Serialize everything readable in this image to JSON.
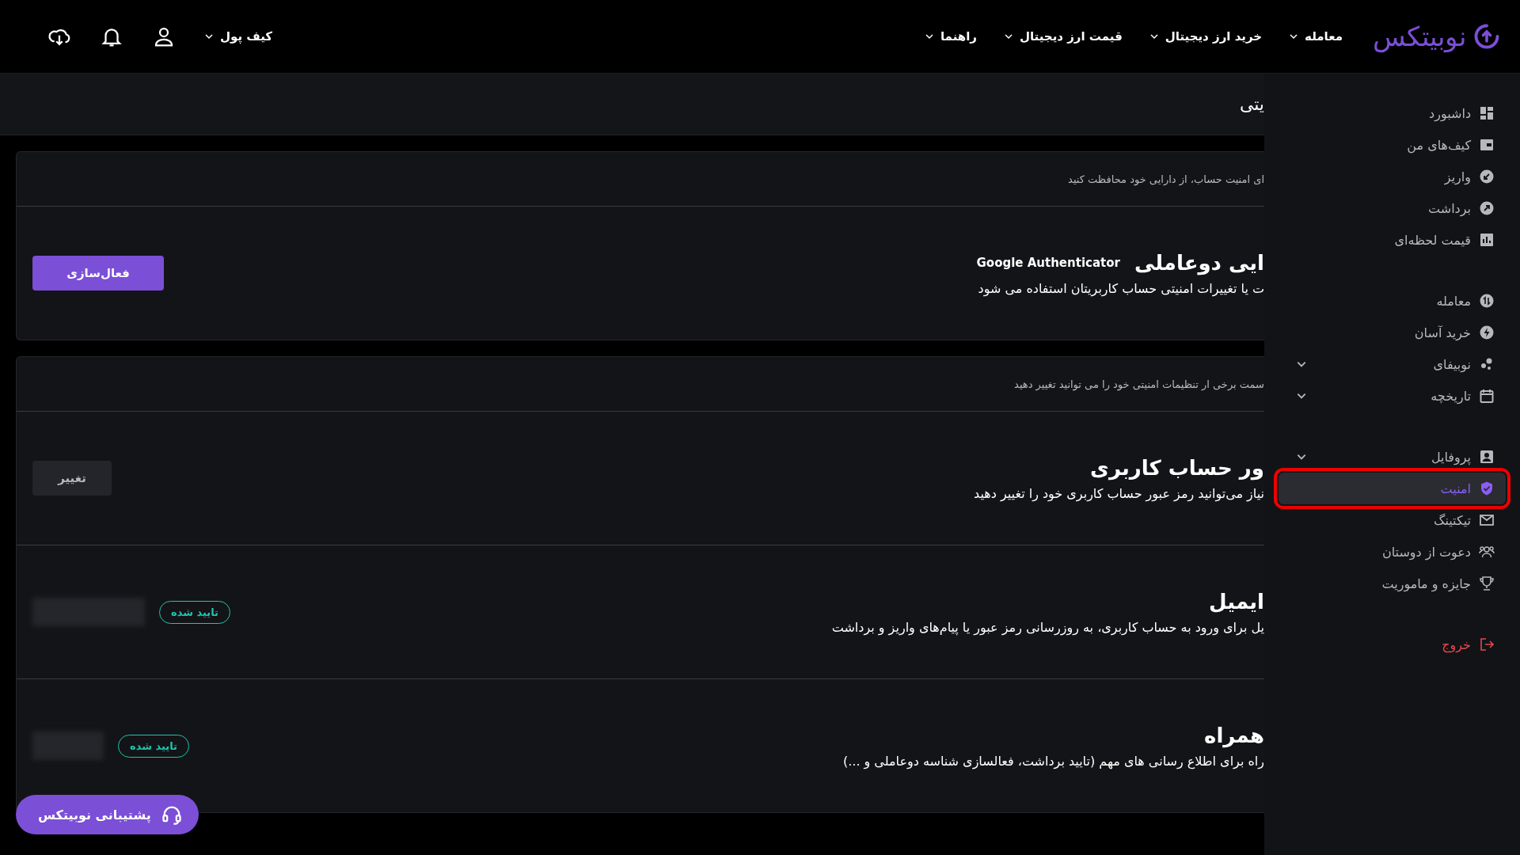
{
  "top_bar": {
    "logo": "نوبیتکس",
    "nav": [
      {
        "label": "معامله"
      },
      {
        "label": "خرید ارز دیجیتال"
      },
      {
        "label": "قیمت ارز دیجیتال"
      },
      {
        "label": "راهنما"
      }
    ],
    "wallet_menu": "کیف پول"
  },
  "page_title": "یتی",
  "cards": [
    {
      "intro": "ای امنیت حساب، از دارایی خود محافظت کنید",
      "rows": [
        {
          "kind": "button",
          "title": "ایی دوعاملی",
          "tag": "Google Authenticator",
          "description": "ت یا تغییرات امنیتی حساب کاربریتان استفاده می شود",
          "action": "فعال‌سازی",
          "primary": true
        }
      ]
    },
    {
      "intro": "سمت برخی ار تنظیمات امنیتی خود را می توانید تغییر دهید",
      "rows": [
        {
          "kind": "button",
          "title": "ور حساب کاربری",
          "description": "نیاز می‌توانید رمز عبور حساب کاربری خود را تغییر دهید",
          "action": "تغییر",
          "primary": false
        },
        {
          "kind": "verified",
          "title": "ایمیل",
          "description": "یل برای ورود به حساب کاربری، به روزرسانی رمز عبور یا پیام‌های واریز و برداشت",
          "badge": "تایید شده"
        },
        {
          "kind": "verified",
          "title": "همراه",
          "description": "راه برای اطلاع رسانی های مهم (تایید برداشت، فعالسازی شناسه دوعاملی و ...)",
          "badge": "تایید شده"
        }
      ]
    }
  ],
  "sidebar": {
    "groups": [
      [
        {
          "label": "داشبورد",
          "kind": "link",
          "selected": false
        },
        {
          "label": "کیف‌های من",
          "kind": "link",
          "selected": false
        },
        {
          "label": "واریز",
          "kind": "link",
          "selected": false
        },
        {
          "label": "برداشت",
          "kind": "link",
          "selected": false
        },
        {
          "label": "قیمت لحظه‌ای",
          "kind": "link",
          "selected": false
        }
      ],
      [
        {
          "label": "معامله",
          "kind": "link",
          "selected": false
        },
        {
          "label": "خرید آسان",
          "kind": "link",
          "selected": false
        },
        {
          "label": "نوبیفای",
          "kind": "group",
          "selected": false
        },
        {
          "label": "تاریخچه",
          "kind": "group",
          "selected": false
        }
      ],
      [
        {
          "label": "پروفایل",
          "kind": "group",
          "selected": false
        },
        {
          "label": "امنیت",
          "kind": "link",
          "selected": true
        },
        {
          "label": "تیکتینگ",
          "kind": "link",
          "selected": false
        },
        {
          "label": "دعوت از دوستان",
          "kind": "link",
          "selected": false
        },
        {
          "label": "جایزه و ماموریت",
          "kind": "link",
          "selected": false
        }
      ],
      [
        {
          "label": "خروج",
          "kind": "exit",
          "selected": false
        }
      ]
    ]
  },
  "support_button": "پشتیبانی نوبیتکس"
}
